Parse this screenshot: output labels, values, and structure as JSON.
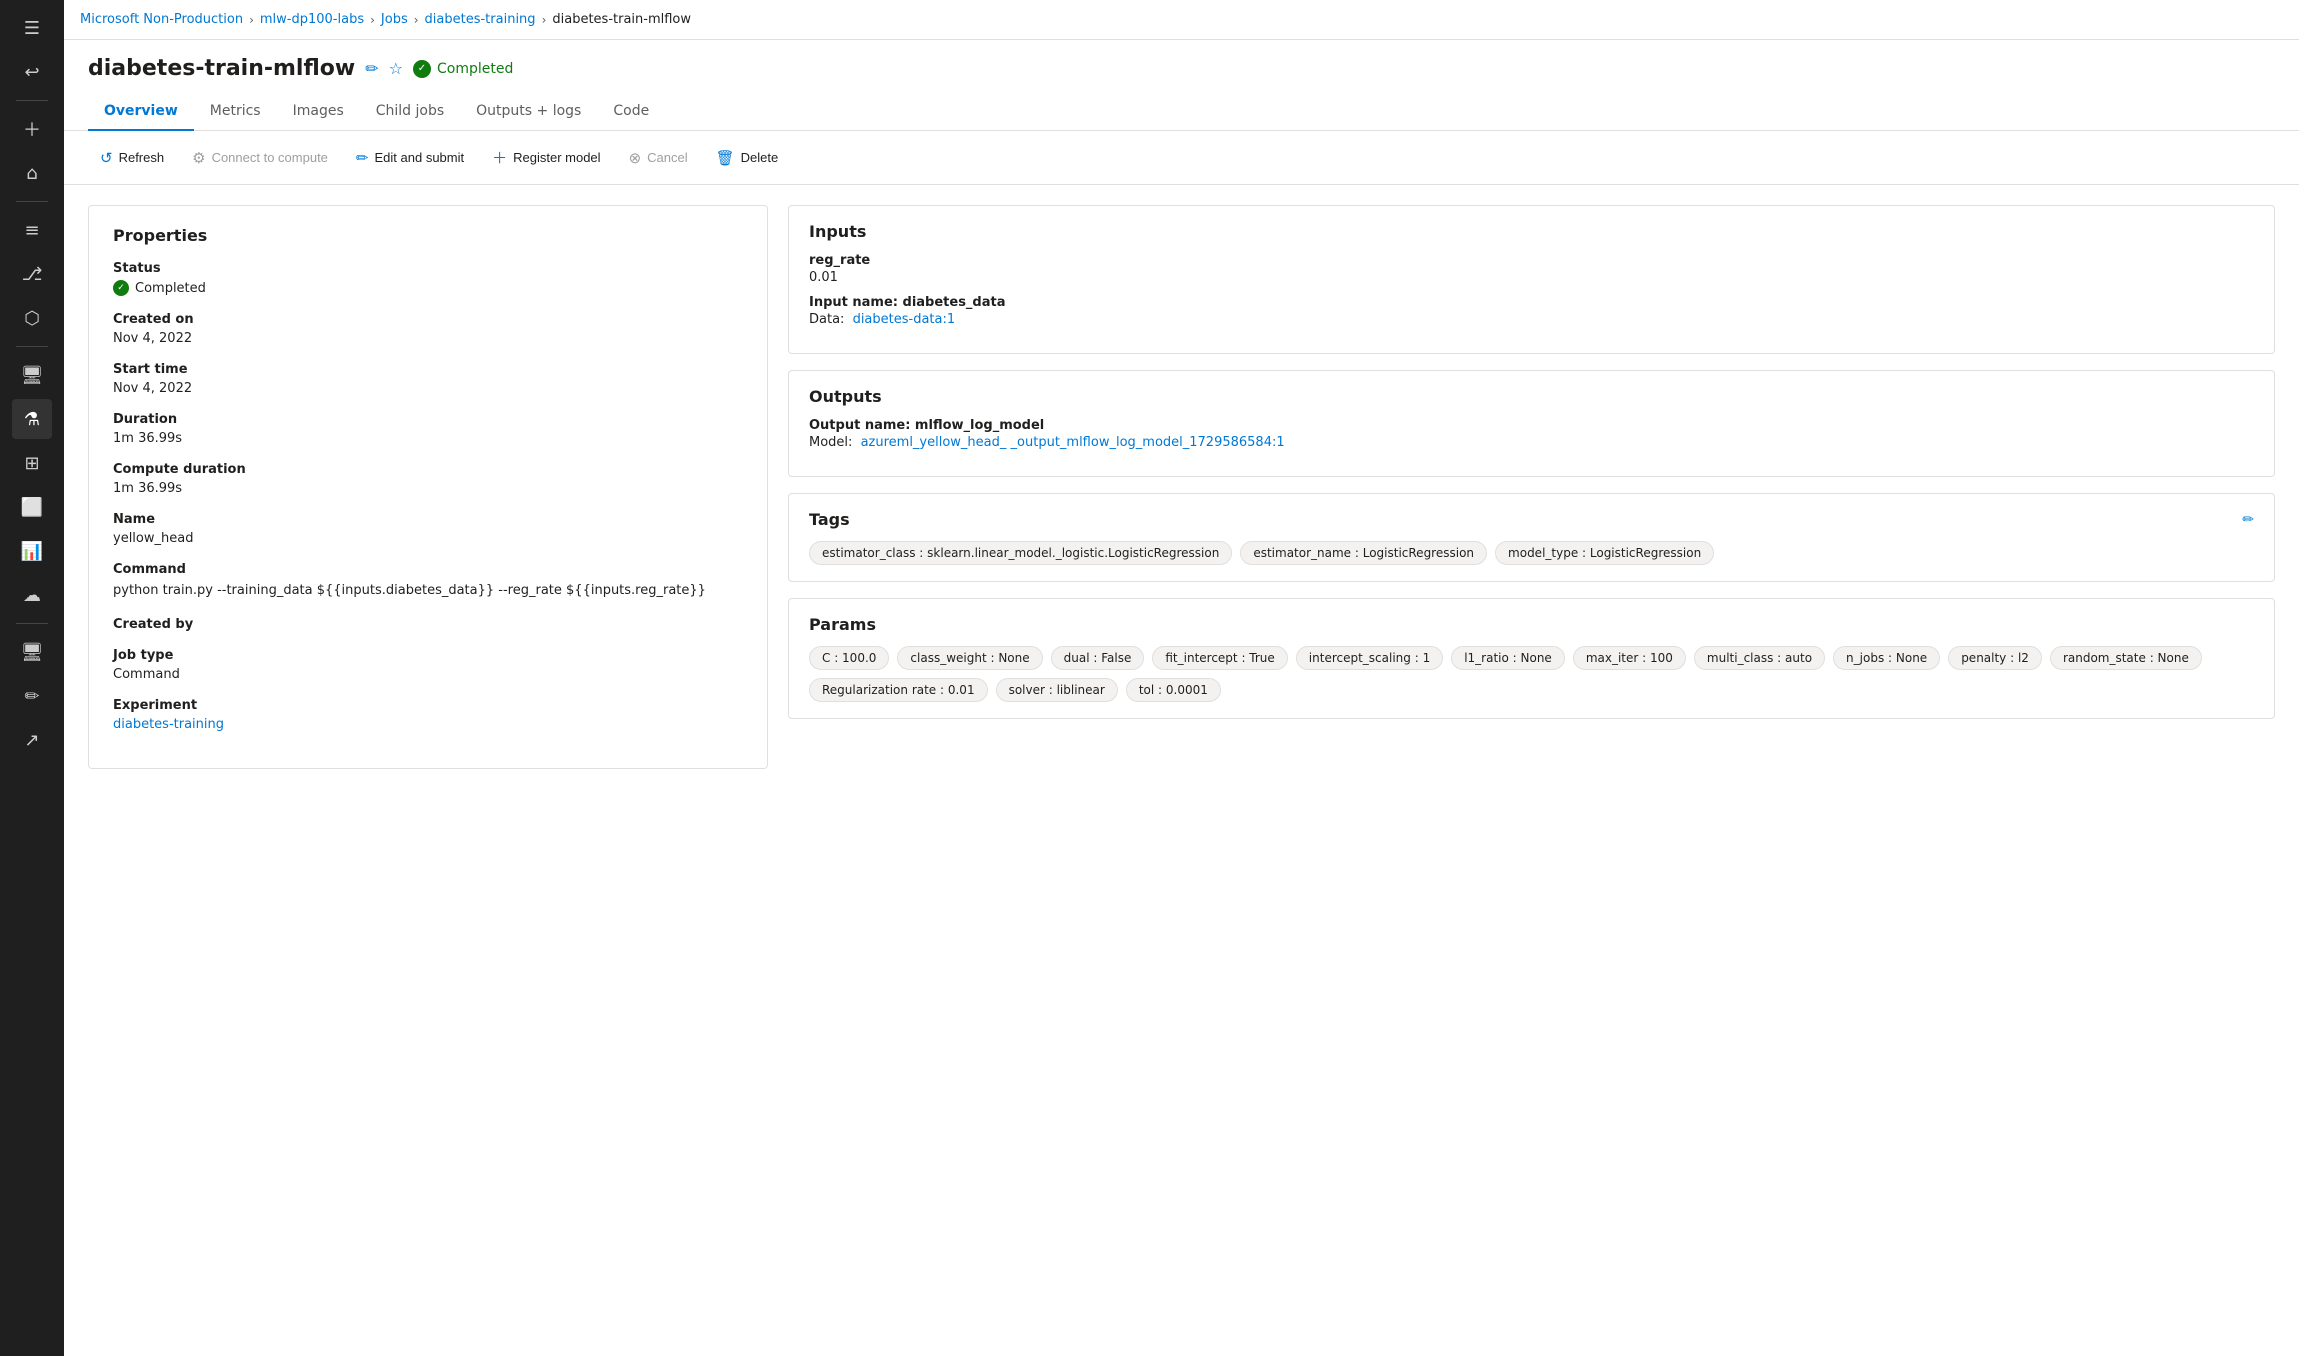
{
  "breadcrumb": {
    "items": [
      {
        "label": "Microsoft Non-Production",
        "link": true
      },
      {
        "label": "mlw-dp100-labs",
        "link": true
      },
      {
        "label": "Jobs",
        "link": true
      },
      {
        "label": "diabetes-training",
        "link": true
      },
      {
        "label": "diabetes-train-mlflow",
        "link": false
      }
    ]
  },
  "page": {
    "title": "diabetes-train-mlflow",
    "status": "Completed"
  },
  "tabs": [
    {
      "label": "Overview",
      "active": true
    },
    {
      "label": "Metrics",
      "active": false
    },
    {
      "label": "Images",
      "active": false
    },
    {
      "label": "Child jobs",
      "active": false
    },
    {
      "label": "Outputs + logs",
      "active": false
    },
    {
      "label": "Code",
      "active": false
    }
  ],
  "toolbar": {
    "refresh_label": "Refresh",
    "connect_label": "Connect to compute",
    "edit_label": "Edit and submit",
    "register_label": "Register model",
    "cancel_label": "Cancel",
    "delete_label": "Delete"
  },
  "properties": {
    "title": "Properties",
    "status_label": "Status",
    "status_value": "Completed",
    "created_on_label": "Created on",
    "created_on_value": "Nov 4, 2022",
    "start_time_label": "Start time",
    "start_time_value": "Nov 4, 2022",
    "duration_label": "Duration",
    "duration_value": "1m 36.99s",
    "compute_duration_label": "Compute duration",
    "compute_duration_value": "1m 36.99s",
    "name_label": "Name",
    "name_value": "yellow_head",
    "command_label": "Command",
    "command_value": "python train.py --training_data ${{inputs.diabetes_data}} --reg_rate ${{inputs.reg_rate}}",
    "created_by_label": "Created by",
    "created_by_value": "",
    "job_type_label": "Job type",
    "job_type_value": "Command",
    "experiment_label": "Experiment",
    "experiment_value": "diabetes-training"
  },
  "inputs": {
    "title": "Inputs",
    "reg_rate_label": "reg_rate",
    "reg_rate_value": "0.01",
    "input_name_label": "Input name: diabetes_data",
    "data_label": "Data:",
    "data_value": "diabetes-data:1"
  },
  "outputs": {
    "title": "Outputs",
    "output_name_label": "Output name: mlflow_log_model",
    "model_label": "Model:",
    "model_value": "azureml_yellow_head_",
    "model_value2": "_output_mlflow_log_model_1729586584:1"
  },
  "tags": {
    "title": "Tags",
    "items": [
      "estimator_class : sklearn.linear_model._logistic.LogisticRegression",
      "estimator_name : LogisticRegression",
      "model_type : LogisticRegression"
    ]
  },
  "params": {
    "title": "Params",
    "items": [
      "C : 100.0",
      "class_weight : None",
      "dual : False",
      "fit_intercept : True",
      "intercept_scaling : 1",
      "l1_ratio : None",
      "max_iter : 100",
      "multi_class : auto",
      "n_jobs : None",
      "penalty : l2",
      "random_state : None",
      "Regularization rate : 0.01",
      "solver : liblinear",
      "tol : 0.0001"
    ]
  },
  "sidebar": {
    "icons": [
      {
        "name": "menu-icon",
        "symbol": "☰"
      },
      {
        "name": "back-icon",
        "symbol": "↩"
      },
      {
        "name": "add-icon",
        "symbol": "+"
      },
      {
        "name": "home-icon",
        "symbol": "⌂"
      },
      {
        "name": "list-icon",
        "symbol": "☰"
      },
      {
        "name": "branch-icon",
        "symbol": "⎇"
      },
      {
        "name": "nodes-icon",
        "symbol": "⬡"
      },
      {
        "name": "compute-icon",
        "symbol": "🖥"
      },
      {
        "name": "flask-icon",
        "symbol": "⚗"
      },
      {
        "name": "grid-icon",
        "symbol": "⊞"
      },
      {
        "name": "workflow-icon",
        "symbol": "⬜"
      },
      {
        "name": "data-icon",
        "symbol": "📊"
      },
      {
        "name": "cloud-icon",
        "symbol": "☁"
      },
      {
        "name": "monitor-icon",
        "symbol": "🖥"
      },
      {
        "name": "edit2-icon",
        "symbol": "✏"
      },
      {
        "name": "export-icon",
        "symbol": "⬛"
      }
    ]
  }
}
